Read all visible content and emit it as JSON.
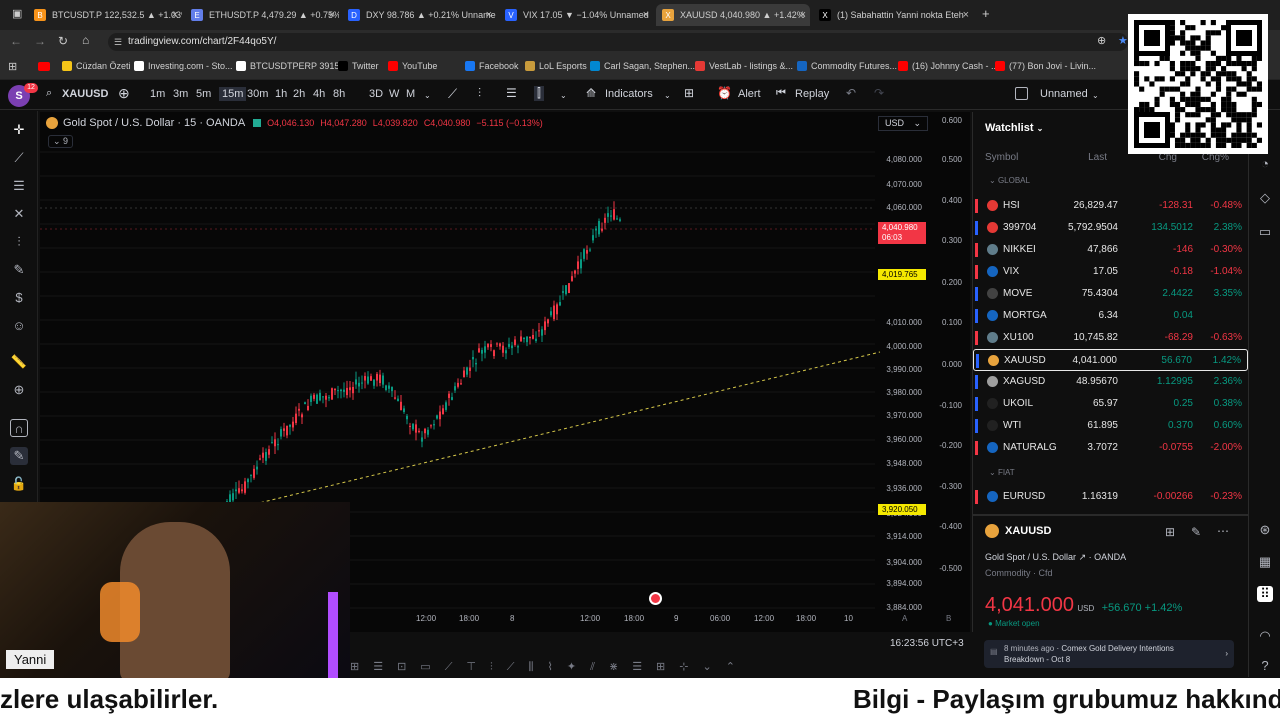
{
  "browser": {
    "tabs": [
      {
        "label": "BTCUSDT.P 122,532.5 ▲ +1.03%",
        "color": "#f7931a",
        "icon": "B"
      },
      {
        "label": "ETHUSDT.P 4,479.29 ▲ +0.75%",
        "color": "#627eea",
        "icon": "E"
      },
      {
        "label": "DXY 98.786 ▲ +0.21% Unname",
        "color": "#2962ff",
        "icon": "D"
      },
      {
        "label": "VIX 17.05 ▼ −1.04% Unnamed",
        "color": "#2962ff",
        "icon": "V"
      },
      {
        "label": "XAUUSD 4,040.980 ▲ +1.42%",
        "color": "#e8a33d",
        "icon": "X"
      },
      {
        "label": "(1) Sabahattin Yanni nokta Eteh",
        "color": "#000000",
        "icon": "X"
      }
    ],
    "url": "tradingview.com/chart/2F44qo5Y/",
    "bookmarks": [
      {
        "label": "Cüzdan Özeti",
        "color": "#f5c518"
      },
      {
        "label": "Investing.com - Sto...",
        "color": "#ffffff"
      },
      {
        "label": "BTCUSDTPERP 3915...",
        "color": "#ffffff"
      },
      {
        "label": "Twitter",
        "color": "#000000"
      },
      {
        "label": "YouTube",
        "color": "#ff0000"
      },
      {
        "label": "Facebook",
        "color": "#1877f2"
      },
      {
        "label": "LoL Esports",
        "color": "#c89b3c"
      },
      {
        "label": "Carl Sagan, Stephen...",
        "color": "#0288d1"
      },
      {
        "label": "VestLab - listings &...",
        "color": "#e53935"
      },
      {
        "label": "Commodity Futures...",
        "color": "#1565c0"
      },
      {
        "label": "(16) Johnny Cash - ...",
        "color": "#ff0000"
      },
      {
        "label": "(77) Bon Jovi - Livin...",
        "color": "#ff0000"
      }
    ]
  },
  "toolbar": {
    "avatar": "S",
    "avatar_badge": "12",
    "symbol": "XAUUSD",
    "intervals": [
      "1m",
      "3m",
      "5m",
      "15m",
      "30m",
      "1h",
      "2h",
      "4h",
      "8h",
      "3D",
      "W",
      "M"
    ],
    "active_interval": "15m",
    "indicators": "Indicators",
    "alert": "Alert",
    "replay": "Replay",
    "layout_name": "Unnamed"
  },
  "chart": {
    "title": "Gold Spot / U.S. Dollar · 15 · OANDA",
    "ohlc": {
      "o": "O4,046.130",
      "h": "H4,047.280",
      "l": "L4,039.820",
      "c": "C4,040.980",
      "chg": "−5.115 (−0.13%)"
    },
    "indicator_count": "9",
    "currency": "USD",
    "price_labels": [
      "4,080.000",
      "4,070.000",
      "4,060.000",
      "4,050.000",
      "4,030.000",
      "4,010.000",
      "4,000.000",
      "3,990.000",
      "3,980.000",
      "3,970.000",
      "3,960.000",
      "3,948.000",
      "3,936.000",
      "3,924.000",
      "3,914.000",
      "3,904.000",
      "3,894.000",
      "3,884.000"
    ],
    "secondary_labels": [
      "0.600",
      "0.500",
      "0.400",
      "0.300",
      "0.200",
      "0.100",
      "0.000",
      "-0.100",
      "-0.200",
      "-0.300",
      "-0.400",
      "-0.500"
    ],
    "current_price": "4,040.980",
    "current_timer": "06:03",
    "yellow_label_1": "4,019.765",
    "yellow_label_2": "3,920.050",
    "time_labels": [
      "12:00",
      "18:00",
      "8",
      "12:00",
      "18:00",
      "9",
      "06:00",
      "12:00",
      "18:00",
      "10"
    ],
    "clock": "16:23:56 UTC+3",
    "trend_color": "#d6c84a",
    "up_color": "#089981",
    "down_color": "#f23645"
  },
  "watchlist": {
    "title": "Watchlist",
    "columns": {
      "symbol": "Symbol",
      "last": "Last",
      "chg": "Chg",
      "chgp": "Chg%"
    },
    "section_global": "GLOBAL",
    "section_fiat": "FIAT",
    "rows": [
      {
        "sym": "HSI",
        "last": "26,829.47",
        "chg": "-128.31",
        "pct": "-0.48%",
        "dir": "down",
        "ic": "#e53935"
      },
      {
        "sym": "399704",
        "last": "5,792.9504",
        "chg": "134.5012",
        "pct": "2.38%",
        "dir": "up",
        "ic": "#e53935"
      },
      {
        "sym": "NIKKEI",
        "last": "47,866",
        "chg": "-146",
        "pct": "-0.30%",
        "dir": "down",
        "ic": "#607d8b"
      },
      {
        "sym": "VIX",
        "last": "17.05",
        "chg": "-0.18",
        "pct": "-1.04%",
        "dir": "down",
        "ic": "#1565c0"
      },
      {
        "sym": "MOVE",
        "last": "75.4304",
        "chg": "2.4422",
        "pct": "3.35%",
        "dir": "up",
        "ic": "#424242"
      },
      {
        "sym": "MORTGA",
        "last": "6.34",
        "chg": "0.04",
        "pct": "",
        "dir": "up",
        "ic": "#1565c0"
      },
      {
        "sym": "XU100",
        "last": "10,745.82",
        "chg": "-68.29",
        "pct": "-0.63%",
        "dir": "down",
        "ic": "#607d8b"
      },
      {
        "sym": "XAUUSD",
        "last": "4,041.000",
        "chg": "56.670",
        "pct": "1.42%",
        "dir": "up",
        "ic": "#e8a33d",
        "selected": true
      },
      {
        "sym": "XAGUSD",
        "last": "48.95670",
        "chg": "1.12995",
        "pct": "2.36%",
        "dir": "up",
        "ic": "#9e9e9e"
      },
      {
        "sym": "UKOIL",
        "last": "65.97",
        "chg": "0.25",
        "pct": "0.38%",
        "dir": "up",
        "ic": "#212121"
      },
      {
        "sym": "WTI",
        "last": "61.895",
        "chg": "0.370",
        "pct": "0.60%",
        "dir": "up",
        "ic": "#212121"
      },
      {
        "sym": "NATURALG",
        "last": "3.7072",
        "chg": "-0.0755",
        "pct": "-2.00%",
        "dir": "down",
        "ic": "#1565c0"
      }
    ],
    "fiat_rows": [
      {
        "sym": "EURUSD",
        "last": "1.16319",
        "chg": "-0.00266",
        "pct": "-0.23%",
        "dir": "down",
        "ic": "#1565c0"
      }
    ]
  },
  "details": {
    "symbol": "XAUUSD",
    "name": "Gold Spot / U.S. Dollar",
    "exchange": "OANDA",
    "category": "Commodity · Cfd",
    "price": "4,041.000",
    "currency": "USD",
    "change": "+56.670 +1.42%",
    "market_status": "Market open",
    "news_time": "8 minutes ago",
    "news_text": "Comex Gold Delivery Intentions Breakdown - Oct 8"
  },
  "overlay": {
    "webcam_name": "Yanni",
    "subtitle_left": "zlere ulaşabilirler.",
    "subtitle_right": "Bilgi - Paylaşım grubumuz hakkında"
  }
}
